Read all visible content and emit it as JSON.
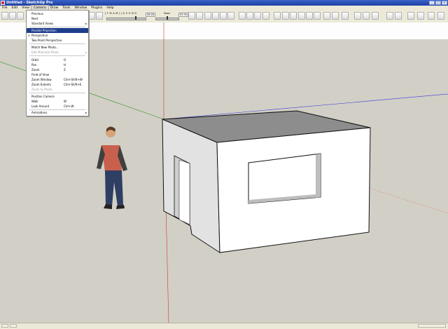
{
  "window": {
    "title": "Untitled - SketchUp Pro",
    "buttons": [
      "_",
      "□",
      "×"
    ]
  },
  "menubar": {
    "items": [
      "File",
      "Edit",
      "View",
      "Camera",
      "Draw",
      "Tools",
      "Window",
      "Plugins",
      "Help"
    ],
    "active": "Camera"
  },
  "toolbar": {
    "months": "J F M A M J J A S O N D",
    "time_start": "06:26",
    "time_noon": "Noon",
    "time_end": "05:35"
  },
  "camera_menu": {
    "items": [
      {
        "label": "Previous",
        "shortcut": "",
        "submenu": false,
        "checked": false,
        "disabled": false,
        "highlight": false
      },
      {
        "label": "Next",
        "shortcut": "",
        "submenu": false,
        "checked": false,
        "disabled": false,
        "highlight": false
      },
      {
        "label": "Standard Views",
        "shortcut": "",
        "submenu": true,
        "checked": false,
        "disabled": false,
        "highlight": false
      },
      {
        "label": "Parallel Projection",
        "shortcut": "",
        "submenu": false,
        "checked": false,
        "disabled": false,
        "highlight": true
      },
      {
        "label": "Perspective",
        "shortcut": "",
        "submenu": false,
        "checked": true,
        "disabled": false,
        "highlight": false
      },
      {
        "label": "Two-Point Perspective",
        "shortcut": "",
        "submenu": false,
        "checked": false,
        "disabled": false,
        "highlight": false
      },
      {
        "label": "Match New Photo...",
        "shortcut": "",
        "submenu": false,
        "checked": false,
        "disabled": false,
        "highlight": false
      },
      {
        "label": "Edit Matched Photo",
        "shortcut": "",
        "submenu": true,
        "checked": false,
        "disabled": true,
        "highlight": false
      },
      {
        "label": "Orbit",
        "shortcut": "O",
        "submenu": false,
        "checked": false,
        "disabled": false,
        "highlight": false
      },
      {
        "label": "Pan",
        "shortcut": "H",
        "submenu": false,
        "checked": false,
        "disabled": false,
        "highlight": false
      },
      {
        "label": "Zoom",
        "shortcut": "Z",
        "submenu": false,
        "checked": false,
        "disabled": false,
        "highlight": false
      },
      {
        "label": "Field of View",
        "shortcut": "",
        "submenu": false,
        "checked": false,
        "disabled": false,
        "highlight": false
      },
      {
        "label": "Zoom Window",
        "shortcut": "Ctrl+Shift+W",
        "submenu": false,
        "checked": false,
        "disabled": false,
        "highlight": false
      },
      {
        "label": "Zoom Extents",
        "shortcut": "Ctrl+Shift+E",
        "submenu": false,
        "checked": false,
        "disabled": false,
        "highlight": false
      },
      {
        "label": "Zoom to Photo",
        "shortcut": "",
        "submenu": false,
        "checked": false,
        "disabled": true,
        "highlight": false
      },
      {
        "label": "Position Camera",
        "shortcut": "",
        "submenu": false,
        "checked": false,
        "disabled": false,
        "highlight": false
      },
      {
        "label": "Walk",
        "shortcut": "W",
        "submenu": false,
        "checked": false,
        "disabled": false,
        "highlight": false
      },
      {
        "label": "Look Around",
        "shortcut": "Ctrl+W",
        "submenu": false,
        "checked": false,
        "disabled": false,
        "highlight": false
      },
      {
        "label": "Animations",
        "shortcut": "",
        "submenu": true,
        "checked": false,
        "disabled": false,
        "highlight": false
      }
    ]
  },
  "colors": {
    "sky": "#fdfdfd",
    "ground": "#d2cfc6",
    "menu_highlight": "#1d3e8c",
    "roof": "#8d8d8d",
    "wall": "#ffffff",
    "wall_side": "#e2e2e2",
    "axis_red": "#cc3a3a",
    "axis_green": "#2f9b2f",
    "axis_blue": "#3a3ad8"
  },
  "icons": [
    "select-icon",
    "eraser-icon",
    "paint-icon",
    "shadow-icon",
    "orbit-icon",
    "pan-icon",
    "zoom-icon",
    "walk-icon",
    "section-icon",
    "house-icon",
    "views-icon",
    "style-icon"
  ]
}
